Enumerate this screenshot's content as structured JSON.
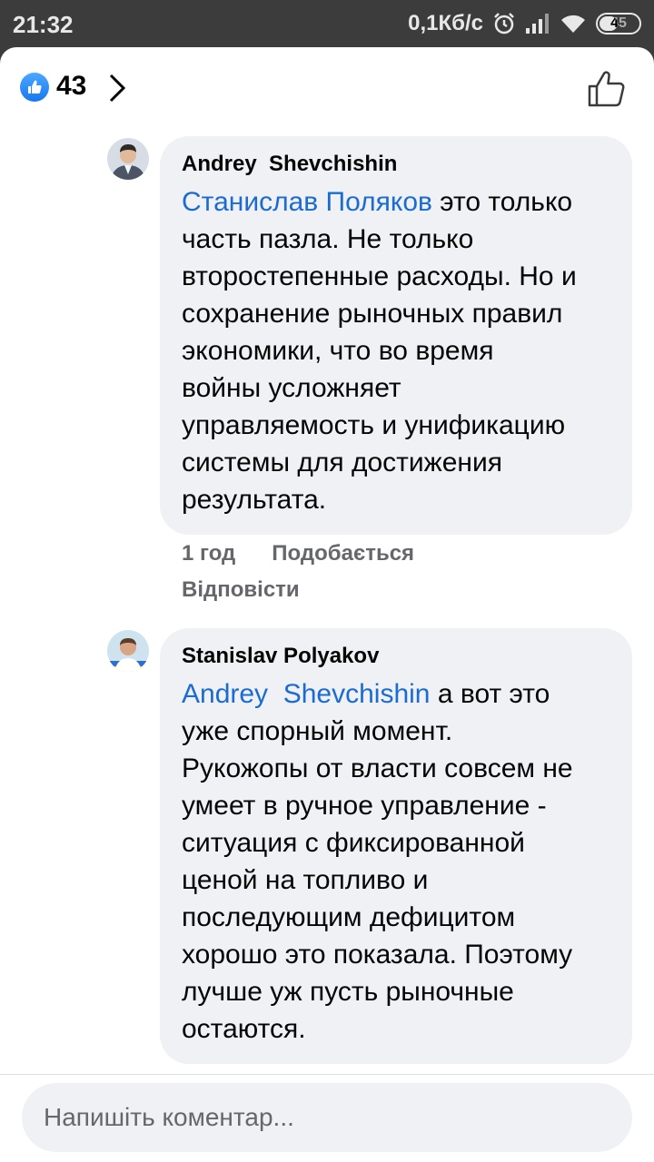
{
  "status_bar": {
    "time": "21:32",
    "net_speed": "0,1Кб/с",
    "battery": "45"
  },
  "header": {
    "like_count": "43"
  },
  "comments": [
    {
      "author": "Andrey  Shevchishin",
      "mention": "Станислав Поляков",
      "text_lines": [
        " это только",
        "часть пазла.  Не только",
        "второстепенные расходы. Но и",
        "сохранение рыночных правил",
        "экономики, что во время",
        "войны усложняет",
        "управляемость и унификацию",
        "системы для достижения",
        "результата."
      ],
      "time_ago": "1 год",
      "like_label": "Подобається",
      "reply_label": "Відповісти"
    },
    {
      "author": "Stanislav Polyakov",
      "mention": "Andrey  Shevchishin",
      "text_lines": [
        " а вот это",
        "уже спорный момент.",
        "Рукожопы от власти совсем не",
        "умеет в ручное управление -",
        "ситуация с фиксированной",
        "ценой на топливо и",
        "последующим дефицитом",
        "хорошо это показала. Поэтому",
        "лучше уж пусть рыночные",
        "остаются."
      ]
    }
  ],
  "composer": {
    "placeholder": "Напишіть коментар..."
  },
  "colors": {
    "accent_blue": "#1877f2",
    "mention_blue": "#1b6bd1",
    "bubble_bg": "#eff1f4",
    "secondary_text": "#65676b"
  },
  "icons": [
    "like-reaction-icon",
    "chevron-right-icon",
    "thumbs-up-outline-icon",
    "alarm-icon",
    "signal-icon",
    "wifi-icon",
    "battery-icon"
  ]
}
